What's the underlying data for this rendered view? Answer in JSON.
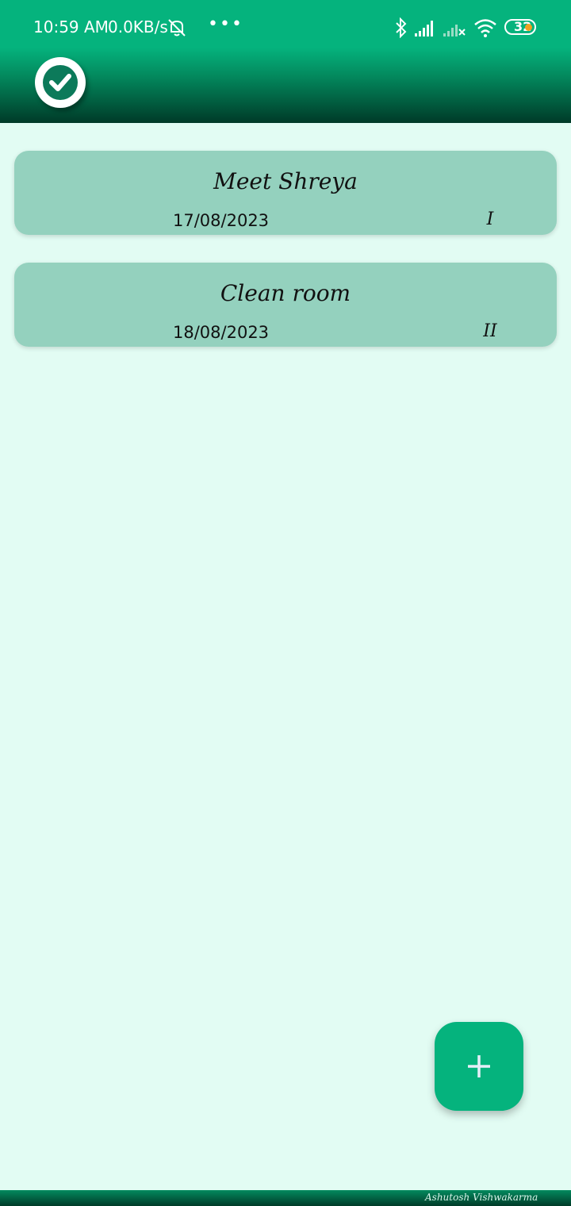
{
  "status_bar": {
    "time": "10:59 AM",
    "net_speed": "0.0KB/s",
    "more": "•••",
    "battery": "32",
    "icons": [
      "bell-off-icon",
      "bluetooth-icon",
      "signal-icon",
      "signal-x-icon",
      "wifi-icon",
      "battery-icon"
    ]
  },
  "app": {
    "logo_icon": "check-circle-icon",
    "colors": {
      "primary": "#05b37d",
      "dark": "#003a28",
      "card": "#94d1be",
      "background": "#e2fcf3"
    }
  },
  "tasks": [
    {
      "title": "Meet Shreya",
      "date": "17/08/2023",
      "priority": "I"
    },
    {
      "title": "Clean room",
      "date": "18/08/2023",
      "priority": "II"
    }
  ],
  "fab": {
    "icon": "plus-icon"
  },
  "footer": {
    "credit": "Ashutosh Vishwakarma"
  }
}
